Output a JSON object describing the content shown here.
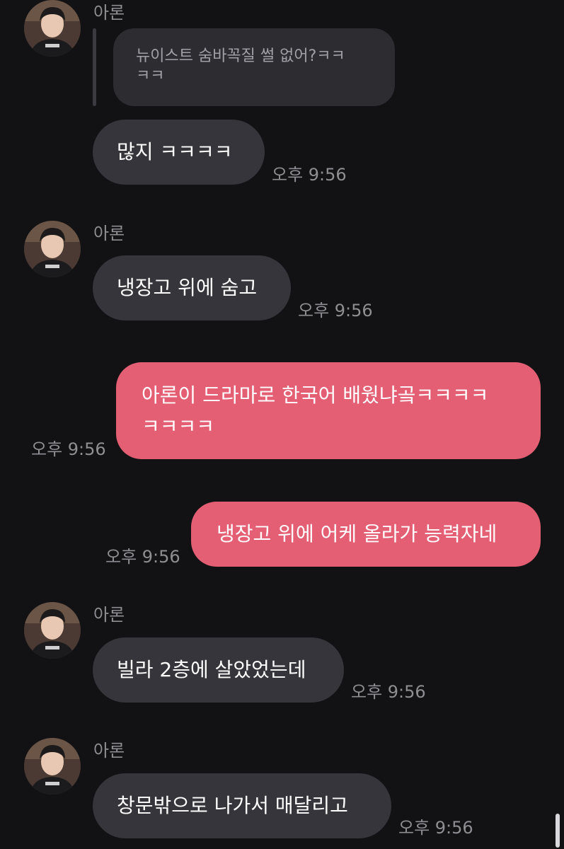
{
  "colors": {
    "background": "#121215",
    "incoming_bubble": "#35353b",
    "outgoing_bubble": "#e45f73",
    "meta_text": "#8e8e93"
  },
  "messages": [
    {
      "direction": "incoming",
      "sender": "아론",
      "quote": "뉴이스트 숨바꼭질 썰 없어?ㅋㅋ ㅋㅋ",
      "text": "많지 ㅋㅋㅋㅋ",
      "time": "오후 9:56"
    },
    {
      "direction": "incoming",
      "sender": "아론",
      "text": "냉장고 위에 숨고",
      "time": "오후 9:56"
    },
    {
      "direction": "outgoing",
      "text_line1": "아론이 드라마로 한국어 배웠냐곸ㅋㅋㅋㅋ",
      "text_line2": "ㅋㅋㅋㅋ",
      "time": "오후 9:56"
    },
    {
      "direction": "outgoing",
      "text": "냉장고 위에 어케 올라가 능력자네",
      "time": "오후 9:56"
    },
    {
      "direction": "incoming",
      "sender": "아론",
      "text": "빌라 2층에 살았었는데",
      "time": "오후 9:56"
    },
    {
      "direction": "incoming",
      "sender": "아론",
      "text": "창문밖으로 나가서 매달리고",
      "time": "오후 9:56"
    }
  ]
}
